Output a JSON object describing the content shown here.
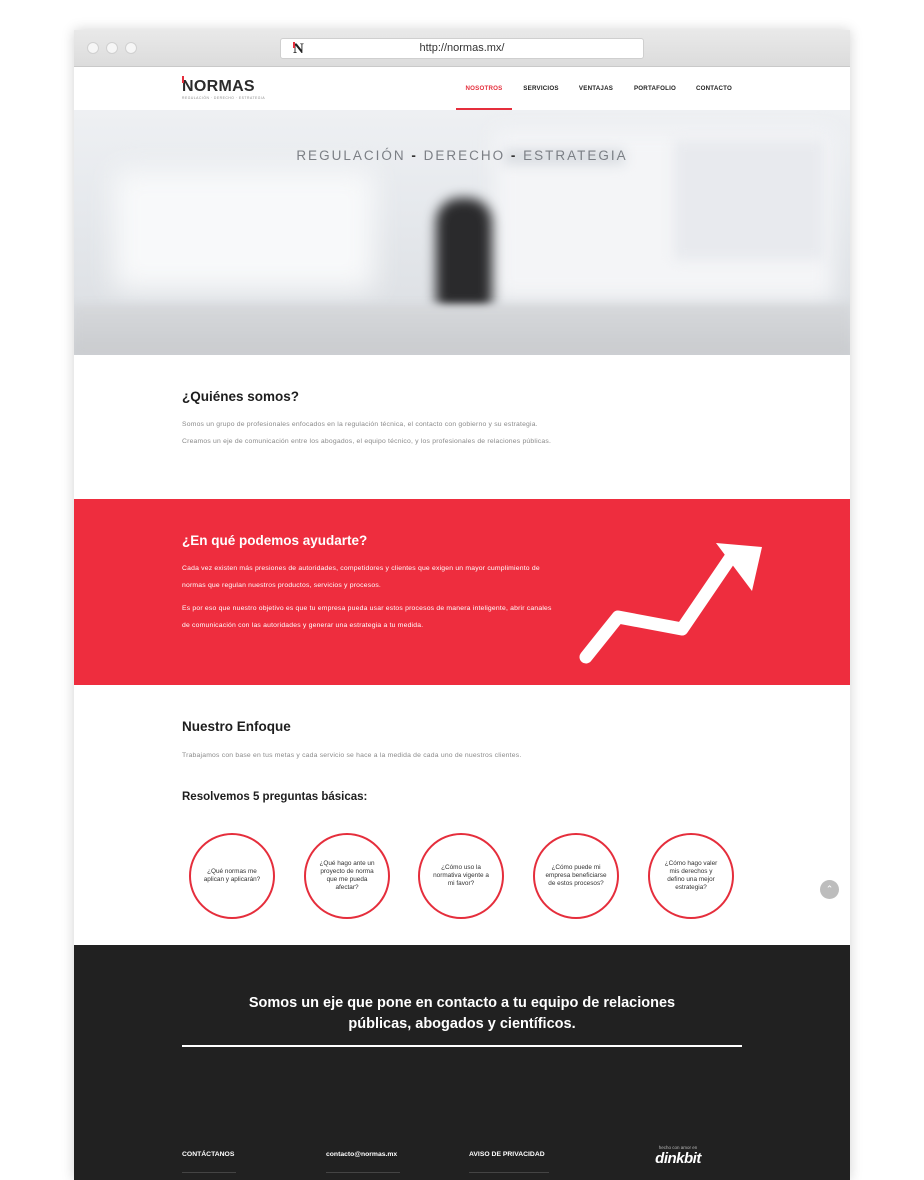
{
  "browser": {
    "url": "http://normas.mx/",
    "favicon_letter": "N"
  },
  "nav": {
    "logo": "NORMAS",
    "logo_tagline": "REGULACIÓN · DERECHO · ESTRATEGIA",
    "items": [
      "NOSOTROS",
      "SERVICIOS",
      "VENTAJAS",
      "PORTAFOLIO",
      "CONTACTO"
    ],
    "active": "NOSOTROS"
  },
  "hero": {
    "words": [
      "REGULACIÓN",
      "DERECHO",
      "ESTRATEGIA"
    ],
    "separator": "-"
  },
  "about": {
    "title": "¿Quiénes somos?",
    "text": "Somos un grupo de profesionales enfocados en la regulación técnica, el contacto con gobierno y su estrategia. Creamos un eje de comunicación entre los abogados, el equipo técnico, y los profesionales de relaciones públicas."
  },
  "help": {
    "title": "¿En qué podemos ayudarte?",
    "p1": "Cada vez existen más presiones de autoridades, competidores y clientes que exigen un mayor cumplimiento de normas que regulan nuestros productos, servicios y procesos.",
    "p2": "Es por eso que nuestro objetivo es que tu empresa pueda usar estos procesos de manera inteligente, abrir canales de comunicación con las autoridades y generar una estrategia a tu medida."
  },
  "focus": {
    "title": "Nuestro Enfoque",
    "intro": "Trabajamos con base en tus metas y cada servicio se hace a la medida de cada uno de nuestros clientes.",
    "subtitle": "Resolvemos 5 preguntas básicas:",
    "questions": [
      "¿Qué normas me aplican y aplicarán?",
      "¿Qué hago ante un proyecto de norma que me pueda afectar?",
      "¿Cómo uso la normativa vigente a mi favor?",
      "¿Cómo puede mi empresa beneficiarse de estos procesos?",
      "¿Cómo hago valer mis derechos y defino una mejor estrategia?"
    ]
  },
  "scroll_top_icon": "chevron-up-icon",
  "claim": {
    "text": "Somos un eje que pone en contacto a tu equipo de relaciones públicas, abogados y científicos."
  },
  "footer": {
    "contact_label": "CONTÁCTANOS",
    "email": "contacto@normas.mx",
    "privacy": "AVISO DE PRIVACIDAD",
    "made_with": "hecho con amor en",
    "brand": "dinkbit"
  },
  "colors": {
    "accent": "#ee2d3e",
    "dark": "#212121"
  }
}
